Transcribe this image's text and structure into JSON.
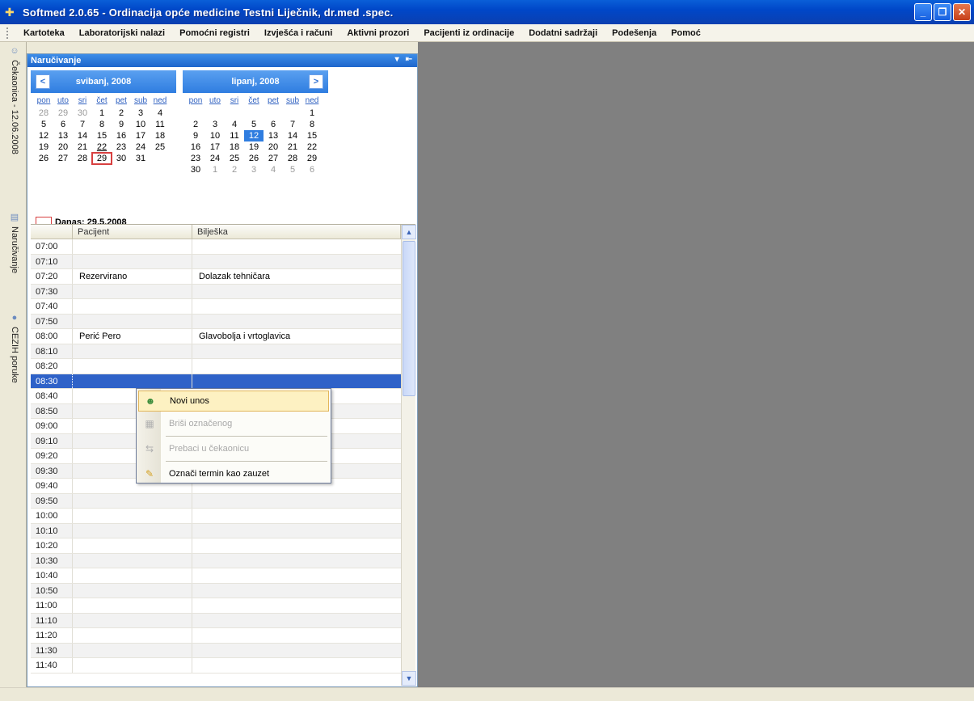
{
  "window": {
    "title": "Softmed 2.0.65 - Ordinacija opće medicine Testni Liječnik, dr.med .spec.",
    "minimize": "_",
    "restore": "❐",
    "close": "✕"
  },
  "menu": [
    "Kartoteka",
    "Laboratorijski nalazi",
    "Pomoćni registri",
    "Izvješća i računi",
    "Aktivni prozori",
    "Pacijenti iz ordinacije",
    "Dodatni sadržaji",
    "Podešenja",
    "Pomoć"
  ],
  "side_tabs": {
    "cekaonica": "Čekaonica - 12.06.2008",
    "narucivanje": "Naručivanje",
    "cezih": "CEZIH poruke"
  },
  "panel": {
    "title": "Naručivanje",
    "pin": "▾",
    "dock": "⇤"
  },
  "calendar": {
    "prev": "<",
    "next": ">",
    "weekdays": [
      "pon",
      "uto",
      "sri",
      "čet",
      "pet",
      "sub",
      "ned"
    ],
    "left_month": {
      "label": "svibanj, 2008",
      "days": [
        [
          "28",
          "29",
          "30",
          "1",
          "2",
          "3",
          "4"
        ],
        [
          "5",
          "6",
          "7",
          "8",
          "9",
          "10",
          "11"
        ],
        [
          "12",
          "13",
          "14",
          "15",
          "16",
          "17",
          "18"
        ],
        [
          "19",
          "20",
          "21",
          "22",
          "23",
          "24",
          "25"
        ],
        [
          "26",
          "27",
          "28",
          "29",
          "30",
          "31",
          ""
        ]
      ]
    },
    "right_month": {
      "label": "lipanj, 2008",
      "days": [
        [
          "",
          "",
          "",
          "",
          "",
          "",
          "1"
        ],
        [
          "2",
          "3",
          "4",
          "5",
          "6",
          "7",
          "8"
        ],
        [
          "9",
          "10",
          "11",
          "12",
          "13",
          "14",
          "15"
        ],
        [
          "16",
          "17",
          "18",
          "19",
          "20",
          "21",
          "22"
        ],
        [
          "23",
          "24",
          "25",
          "26",
          "27",
          "28",
          "29"
        ],
        [
          "30",
          "1",
          "2",
          "3",
          "4",
          "5",
          "6"
        ]
      ]
    },
    "today_label": "Danas: 29.5.2008"
  },
  "schedule": {
    "headers": {
      "patient": "Pacijent",
      "note": "Bilješka"
    },
    "rows": [
      {
        "time": "07:00",
        "patient": "",
        "note": ""
      },
      {
        "time": "07:10",
        "patient": "",
        "note": ""
      },
      {
        "time": "07:20",
        "patient": "Rezervirano",
        "note": "Dolazak tehničara"
      },
      {
        "time": "07:30",
        "patient": "",
        "note": ""
      },
      {
        "time": "07:40",
        "patient": "",
        "note": ""
      },
      {
        "time": "07:50",
        "patient": "",
        "note": ""
      },
      {
        "time": "08:00",
        "patient": "Perić Pero",
        "note": "Glavobolja i vrtoglavica"
      },
      {
        "time": "08:10",
        "patient": "",
        "note": ""
      },
      {
        "time": "08:20",
        "patient": "",
        "note": ""
      },
      {
        "time": "08:30",
        "patient": "",
        "note": ""
      },
      {
        "time": "08:40",
        "patient": "",
        "note": ""
      },
      {
        "time": "08:50",
        "patient": "",
        "note": ""
      },
      {
        "time": "09:00",
        "patient": "",
        "note": ""
      },
      {
        "time": "09:10",
        "patient": "",
        "note": ""
      },
      {
        "time": "09:20",
        "patient": "",
        "note": ""
      },
      {
        "time": "09:30",
        "patient": "",
        "note": ""
      },
      {
        "time": "09:40",
        "patient": "",
        "note": ""
      },
      {
        "time": "09:50",
        "patient": "",
        "note": ""
      },
      {
        "time": "10:00",
        "patient": "",
        "note": ""
      },
      {
        "time": "10:10",
        "patient": "",
        "note": ""
      },
      {
        "time": "10:20",
        "patient": "",
        "note": ""
      },
      {
        "time": "10:30",
        "patient": "",
        "note": ""
      },
      {
        "time": "10:40",
        "patient": "",
        "note": ""
      },
      {
        "time": "10:50",
        "patient": "",
        "note": ""
      },
      {
        "time": "11:00",
        "patient": "",
        "note": ""
      },
      {
        "time": "11:10",
        "patient": "",
        "note": ""
      },
      {
        "time": "11:20",
        "patient": "",
        "note": ""
      },
      {
        "time": "11:30",
        "patient": "",
        "note": ""
      },
      {
        "time": "11:40",
        "patient": "",
        "note": ""
      }
    ],
    "scroll_up": "▲",
    "scroll_down": "▼"
  },
  "context_menu": {
    "new_entry": "Novi unos",
    "delete_selected": "Briši označenog",
    "move_to_waiting": "Prebaci u čekaonicu",
    "mark_busy": "Označi termin kao zauzet"
  },
  "icons": {
    "app": "stethoscope-icon",
    "new_entry": "user-add-icon",
    "delete": "delete-icon",
    "move": "move-icon",
    "mark": "mark-busy-icon"
  }
}
